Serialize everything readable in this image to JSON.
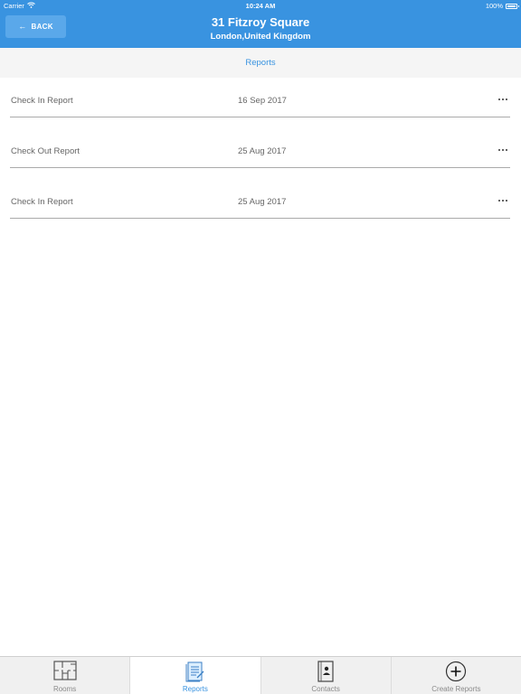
{
  "status_bar": {
    "carrier": "Carrier",
    "time": "10:24 AM",
    "battery": "100%"
  },
  "header": {
    "back_label": "BACK",
    "title": "31 Fitzroy Square",
    "subtitle": "London,United Kingdom"
  },
  "section": {
    "title": "Reports"
  },
  "reports": [
    {
      "name": "Check In Report",
      "date": "16 Sep 2017"
    },
    {
      "name": "Check Out Report",
      "date": "25 Aug 2017"
    },
    {
      "name": "Check In Report",
      "date": "25 Aug 2017"
    }
  ],
  "tabs": [
    {
      "label": "Rooms",
      "icon": "floorplan-icon"
    },
    {
      "label": "Reports",
      "icon": "document-icon"
    },
    {
      "label": "Contacts",
      "icon": "contact-book-icon"
    },
    {
      "label": "Create Reports",
      "icon": "plus-circle-icon"
    }
  ],
  "colors": {
    "header_blue": "#3993e0",
    "back_button": "#5aa8ea",
    "section_background": "#f5f5f5",
    "tab_bar_background": "#f0f0f0",
    "text_gray": "#666666"
  }
}
